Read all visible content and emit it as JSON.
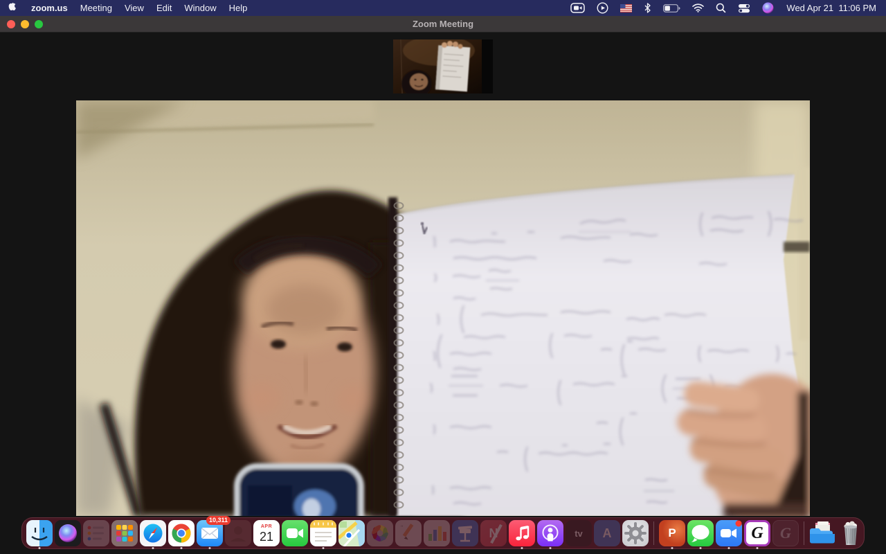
{
  "menu_bar": {
    "menus": [
      "zoom.us",
      "Meeting",
      "View",
      "Edit",
      "Window",
      "Help"
    ],
    "clock": "Wed Apr 21  11:06 PM",
    "status_icons": [
      "zoom-meeting-icon",
      "now-playing-icon",
      "input-source-us-flag-icon",
      "bluetooth-icon",
      "battery-icon",
      "wifi-icon",
      "spotlight-icon",
      "control-center-icon",
      "siri-icon"
    ]
  },
  "window": {
    "title": "Zoom Meeting",
    "traffic_lights": [
      "close",
      "minimize",
      "fullscreen"
    ]
  },
  "video": {
    "main_description": "participant with long dark hair smiling, holding a spiral notebook filled with handwritten calculus problems; beige wall background; phone in foreground",
    "thumbnail_description": "small self-view: participant in dim warm room holding up a white sheet of paper"
  },
  "dock": {
    "items": [
      {
        "id": "finder",
        "label": "Finder",
        "running": true
      },
      {
        "id": "siri",
        "label": "Siri",
        "running": false
      },
      {
        "id": "reminders",
        "label": "Reminders",
        "running": false,
        "dimmed": true
      },
      {
        "id": "launchpad",
        "label": "Launchpad",
        "running": false
      },
      {
        "id": "safari",
        "label": "Safari",
        "running": true
      },
      {
        "id": "chrome",
        "label": "Google Chrome",
        "running": true
      },
      {
        "id": "mail",
        "label": "Mail",
        "running": true,
        "badge": "10,311"
      },
      {
        "id": "contacts",
        "label": "Contacts",
        "running": false,
        "dimmed": true
      },
      {
        "id": "calendar",
        "label": "Calendar",
        "running": false,
        "month": "APR",
        "day": "21"
      },
      {
        "id": "facetime",
        "label": "FaceTime",
        "running": false
      },
      {
        "id": "notes",
        "label": "Notes",
        "running": true
      },
      {
        "id": "maps",
        "label": "Maps",
        "running": false
      },
      {
        "id": "photos",
        "label": "Photos",
        "running": false,
        "dimmed": true
      },
      {
        "id": "pages",
        "label": "Pages",
        "running": false,
        "dimmed": true
      },
      {
        "id": "numbers",
        "label": "Numbers",
        "running": false,
        "dimmed": true
      },
      {
        "id": "keynote",
        "label": "Keynote",
        "running": false,
        "dimmed": true
      },
      {
        "id": "news",
        "label": "News",
        "running": false,
        "dimmed": true,
        "glyph": "N"
      },
      {
        "id": "music",
        "label": "Music",
        "running": true
      },
      {
        "id": "podcasts",
        "label": "Podcasts",
        "running": true
      },
      {
        "id": "tv",
        "label": "TV",
        "running": false,
        "dimmed": true,
        "glyph": "tv"
      },
      {
        "id": "app-store",
        "label": "App Store",
        "running": false,
        "dimmed": true,
        "glyph": "A"
      },
      {
        "id": "system-preferences",
        "label": "System Preferences",
        "running": false
      },
      {
        "id": "powerpoint",
        "label": "Microsoft PowerPoint",
        "running": true,
        "glyph": "P"
      },
      {
        "id": "messages",
        "label": "Messages",
        "running": true
      },
      {
        "id": "zoom",
        "label": "zoom.us",
        "running": true,
        "notification_dot": true
      },
      {
        "id": "g-app",
        "label": "G app",
        "running": true,
        "glyph": "G"
      },
      {
        "id": "g-app-alt",
        "label": "G app (inactive)",
        "running": false,
        "dimmed": true,
        "glyph": "G"
      },
      {
        "id": "documents-folder",
        "label": "Documents folder",
        "running": false
      },
      {
        "id": "trash",
        "label": "Trash (full)",
        "running": false
      }
    ]
  },
  "colors": {
    "menubar_bg": "#272b5e",
    "titlebar_bg": "#3b3839",
    "dock_bg": "#451722",
    "badge_red": "#ec3b30",
    "g_app_border": "#a73ab8",
    "wall_tan": "#d3caae"
  }
}
